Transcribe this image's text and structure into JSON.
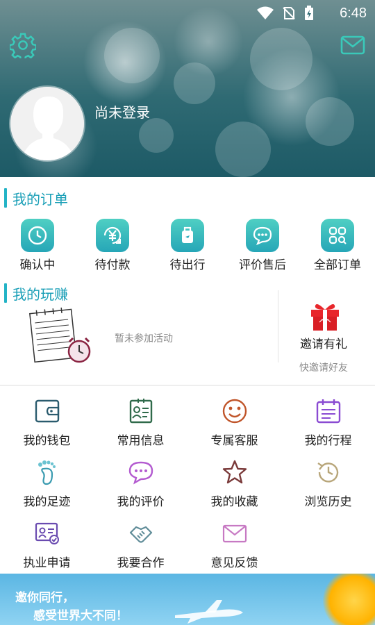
{
  "status_bar": {
    "time": "6:48"
  },
  "header": {
    "login_text": "尚未登录"
  },
  "orders_section": {
    "title": "我的订单",
    "items": [
      {
        "label": "确认中",
        "icon": "clock-icon"
      },
      {
        "label": "待付款",
        "icon": "yuan-icon"
      },
      {
        "label": "待出行",
        "icon": "luggage-icon"
      },
      {
        "label": "评价售后",
        "icon": "chat-icon"
      },
      {
        "label": "全部订单",
        "icon": "grid-search-icon"
      }
    ]
  },
  "earn_section": {
    "title": "我的玩赚",
    "no_activity": "暂未参加活动",
    "invite_title": "邀请有礼",
    "invite_subtitle": "快邀请好友"
  },
  "services": {
    "rows": [
      [
        {
          "label": "我的钱包",
          "icon": "wallet-icon"
        },
        {
          "label": "常用信息",
          "icon": "id-card-icon"
        },
        {
          "label": "专属客服",
          "icon": "smile-icon"
        },
        {
          "label": "我的行程",
          "icon": "calendar-icon"
        }
      ],
      [
        {
          "label": "我的足迹",
          "icon": "footprint-icon"
        },
        {
          "label": "我的评价",
          "icon": "comment-icon"
        },
        {
          "label": "我的收藏",
          "icon": "star-icon"
        },
        {
          "label": "浏览历史",
          "icon": "history-icon"
        }
      ],
      [
        {
          "label": "执业申请",
          "icon": "certificate-icon"
        },
        {
          "label": "我要合作",
          "icon": "handshake-icon"
        },
        {
          "label": "意见反馈",
          "icon": "envelope-icon"
        }
      ]
    ]
  },
  "banner": {
    "line1": "邀你同行，",
    "line2": "感受世界大不同！"
  },
  "colors": {
    "accent": "#1a9fb7",
    "icon_teal": "#2aaabb"
  }
}
